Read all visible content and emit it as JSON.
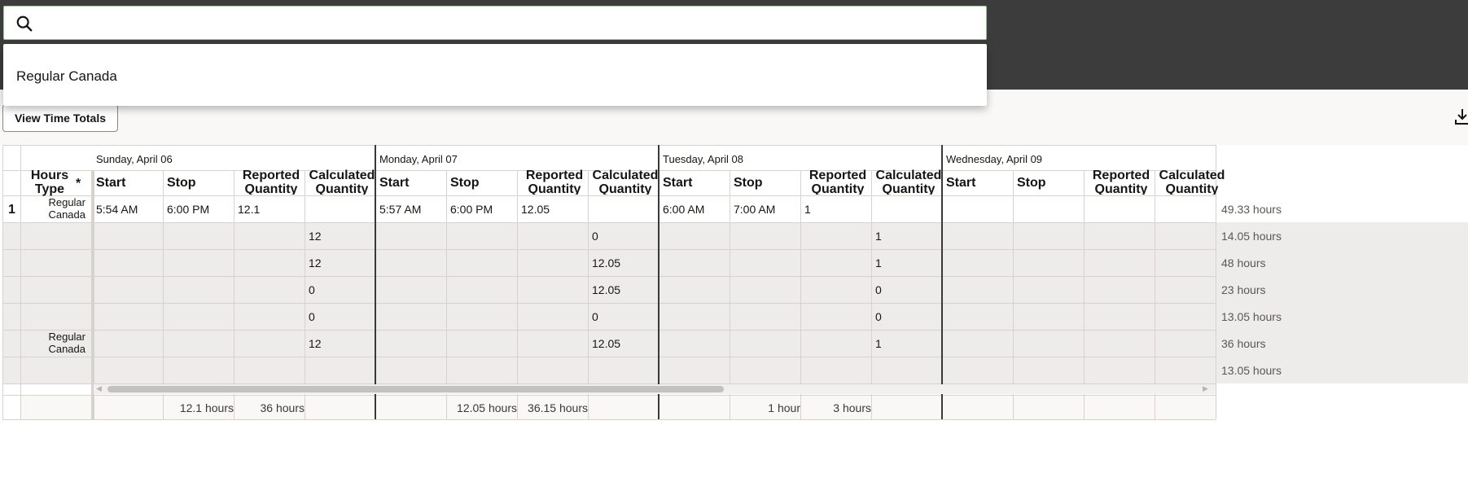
{
  "search": {
    "placeholder": "",
    "value": ""
  },
  "dropdown": {
    "options": [
      "Regular Canada"
    ]
  },
  "toolbar": {
    "view_totals_label": "View Time Totals"
  },
  "days": [
    "Sunday, April 06",
    "Monday, April 07",
    "Tuesday, April 08",
    "Wednesday, April 09"
  ],
  "columns": {
    "hours_type": "Hours Type",
    "required": "*",
    "start": "Start",
    "stop": "Stop",
    "reported": "Reported Quantity",
    "calculated": "Calculated Quantity"
  },
  "rows": [
    {
      "num": "1",
      "type": "Regular Canada",
      "sun": [
        "5:54 AM",
        "6:00 PM",
        "12.1",
        ""
      ],
      "mon": [
        "5:57 AM",
        "6:00 PM",
        "12.05",
        ""
      ],
      "tue": [
        "6:00 AM",
        "7:00 AM",
        "1",
        ""
      ],
      "total": "49.33 hours"
    },
    {
      "num": "",
      "type": "",
      "sun": [
        "",
        "",
        "",
        "12"
      ],
      "mon": [
        "",
        "",
        "",
        "0"
      ],
      "tue": [
        "",
        "",
        "",
        "1"
      ],
      "total": "14.05 hours"
    },
    {
      "num": "",
      "type": "",
      "sun": [
        "",
        "",
        "",
        "12"
      ],
      "mon": [
        "",
        "",
        "",
        "12.05"
      ],
      "tue": [
        "",
        "",
        "",
        "1"
      ],
      "total": "48 hours"
    },
    {
      "num": "",
      "type": "",
      "sun": [
        "",
        "",
        "",
        "0"
      ],
      "mon": [
        "",
        "",
        "",
        "12.05"
      ],
      "tue": [
        "",
        "",
        "",
        "0"
      ],
      "total": "23 hours"
    },
    {
      "num": "",
      "type": "",
      "sun": [
        "",
        "",
        "",
        "0"
      ],
      "mon": [
        "",
        "",
        "",
        "0"
      ],
      "tue": [
        "",
        "",
        "",
        "0"
      ],
      "total": "13.05 hours"
    },
    {
      "num": "",
      "type": "Regular Canada",
      "sun": [
        "",
        "",
        "",
        "12"
      ],
      "mon": [
        "",
        "",
        "",
        "12.05"
      ],
      "tue": [
        "",
        "",
        "",
        "1"
      ],
      "total": "36 hours"
    },
    {
      "num": "",
      "type": "",
      "sun": [
        "",
        "",
        "",
        ""
      ],
      "mon": [
        "",
        "",
        "",
        ""
      ],
      "tue": [
        "",
        "",
        "",
        ""
      ],
      "total": "13.05 hours"
    }
  ],
  "footer": {
    "sun": [
      "12.1 hours",
      "36 hours"
    ],
    "mon": [
      "12.05 hours",
      "36.15 hours"
    ],
    "tue": [
      "1 hour",
      "3 hours"
    ]
  },
  "colors": {
    "accent_border": "#97c58e",
    "topbar": "#3c3c3c",
    "row_alt": "#edecea"
  }
}
